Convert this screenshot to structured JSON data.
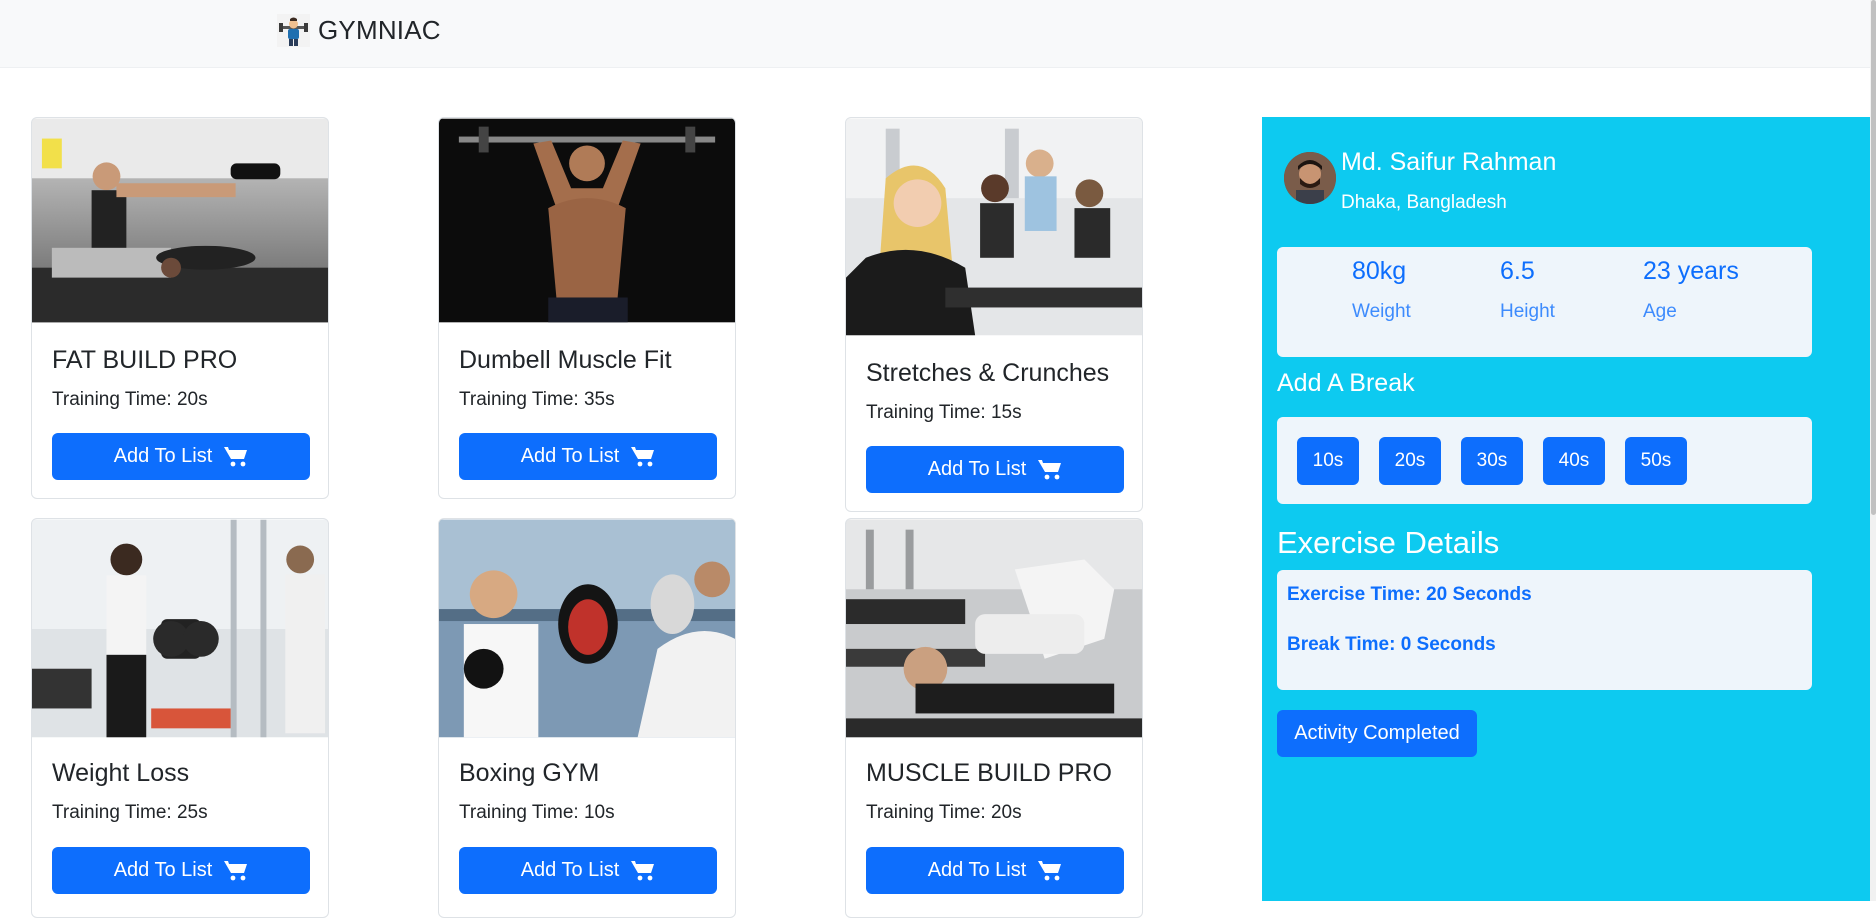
{
  "navbar": {
    "brand": "GYMNIAC"
  },
  "exercises": [
    {
      "title": "FAT BUILD PRO",
      "time": "Training Time: 20s",
      "button": "Add To List"
    },
    {
      "title": "Dumbell Muscle Fit",
      "time": "Training Time: 35s",
      "button": "Add To List"
    },
    {
      "title": "Stretches & Crunches",
      "time": "Training Time: 15s",
      "button": "Add To List"
    },
    {
      "title": "Weight Loss",
      "time": "Training Time: 25s",
      "button": "Add To List"
    },
    {
      "title": "Boxing GYM",
      "time": "Training Time: 10s",
      "button": "Add To List"
    },
    {
      "title": "MUSCLE BUILD PRO",
      "time": "Training Time: 20s",
      "button": "Add To List"
    }
  ],
  "profile": {
    "name": "Md. Saifur Rahman",
    "location": "Dhaka, Bangladesh",
    "stats": [
      {
        "value": "80kg",
        "label": "Weight"
      },
      {
        "value": "6.5",
        "label": "Height"
      },
      {
        "value": "23 years",
        "label": "Age"
      }
    ]
  },
  "breaks": {
    "title": "Add A Break",
    "options": [
      "10s",
      "20s",
      "30s",
      "40s",
      "50s"
    ]
  },
  "details": {
    "title": "Exercise Details",
    "exercise_time": "Exercise Time: 20 Seconds",
    "break_time": "Break Time: 0 Seconds",
    "complete_button": "Activity Completed"
  },
  "colors": {
    "primary": "#0d6efd",
    "sidebar": "#0dcaf0",
    "panel": "#eef5fb",
    "navbar": "#f8f9fa"
  },
  "icons": {
    "brand": "gym-trainer-icon",
    "cart": "cart-icon"
  }
}
